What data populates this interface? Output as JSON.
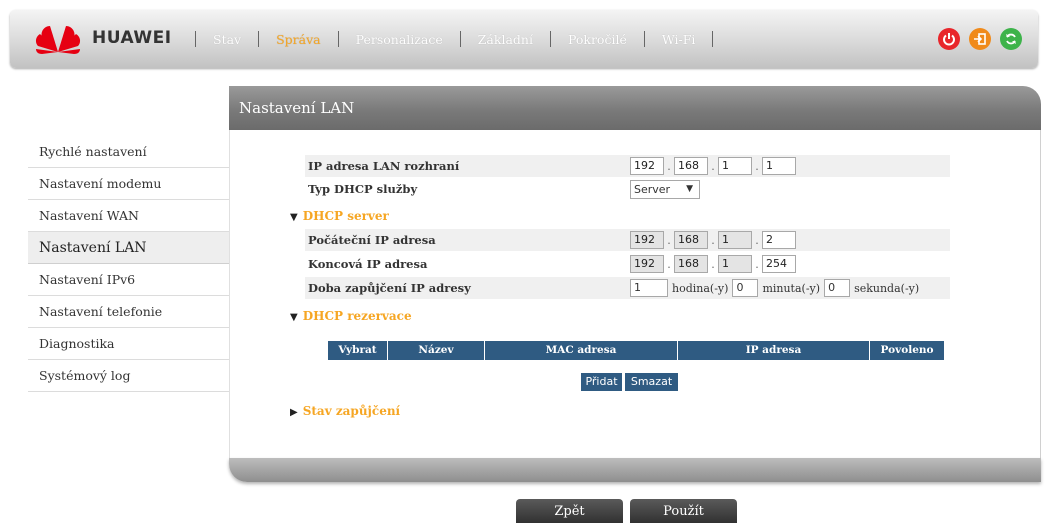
{
  "brand": {
    "name": "HUAWEI"
  },
  "nav": {
    "items": [
      {
        "label": "Stav"
      },
      {
        "label": "Správa"
      },
      {
        "label": "Personalizace"
      },
      {
        "label": "Základní"
      },
      {
        "label": "Pokročilé"
      },
      {
        "label": "Wi-Fi"
      }
    ],
    "active_index": 1,
    "accent": "#f6a623"
  },
  "top_icons": [
    "power-icon",
    "logout-icon",
    "refresh-icon"
  ],
  "sidebar": {
    "items": [
      {
        "label": "Rychlé nastavení"
      },
      {
        "label": "Nastavení modemu"
      },
      {
        "label": "Nastavení WAN"
      },
      {
        "label": "Nastavení LAN"
      },
      {
        "label": "Nastavení IPv6"
      },
      {
        "label": "Nastavení telefonie"
      },
      {
        "label": "Diagnostika"
      },
      {
        "label": "Systémový log"
      }
    ],
    "active_index": 3
  },
  "panel": {
    "title": "Nastavení LAN"
  },
  "lan": {
    "ip_label": "IP adresa LAN rozhraní",
    "ip": [
      "192",
      "168",
      "1",
      "1"
    ],
    "dhcp_type_label": "Typ DHCP služby",
    "dhcp_type_value": "Server"
  },
  "dhcp_server": {
    "title": "DHCP server",
    "start_label": "Počáteční IP adresa",
    "start_ip": [
      "192",
      "168",
      "1",
      "2"
    ],
    "end_label": "Koncová IP adresa",
    "end_ip": [
      "192",
      "168",
      "1",
      "254"
    ],
    "lease_label": "Doba zapůjčení IP adresy",
    "lease_hours": "1",
    "lease_hours_unit": "hodina(-y)",
    "lease_minutes": "0",
    "lease_minutes_unit": "minuta(-y)",
    "lease_seconds": "0",
    "lease_seconds_unit": "sekunda(-y)"
  },
  "dhcp_reservation": {
    "title": "DHCP rezervace",
    "columns": [
      "Vybrat",
      "Název",
      "MAC adresa",
      "IP adresa",
      "Povoleno"
    ],
    "add_label": "Přidat",
    "delete_label": "Smazat"
  },
  "lease_status": {
    "title": "Stav zapůjčení"
  },
  "buttons": {
    "back_label": "Zpět",
    "apply_label": "Použít"
  },
  "colors": {
    "header_blue": "#2f5b82",
    "accent_orange": "#f6a623"
  }
}
